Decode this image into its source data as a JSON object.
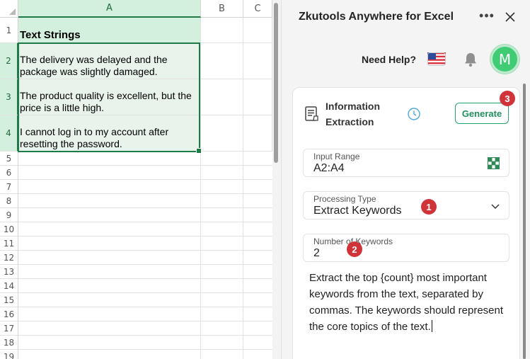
{
  "sheet": {
    "columns": [
      "A",
      "B",
      "C"
    ],
    "rows": [
      "1",
      "2",
      "3",
      "4",
      "5",
      "6",
      "7",
      "8",
      "9",
      "10",
      "11",
      "12",
      "13",
      "14",
      "15",
      "16",
      "17",
      "18",
      "19"
    ],
    "cells": {
      "a1": "Text Strings",
      "a2": "The delivery was delayed and the package was slightly damaged.",
      "a3": "The product quality is excellent, but the price is a little high.",
      "a4": "I cannot log in to my account after resetting the password."
    }
  },
  "panel": {
    "title": "Zkutools Anywhere for Excel",
    "help": "Need Help?",
    "avatar_letter": "M",
    "card": {
      "title": "Information Extraction",
      "generate_label": "Generate",
      "input_range_label": "Input Range",
      "input_range_value": "A2:A4",
      "processing_type_label": "Processing Type",
      "processing_type_value": "Extract Keywords",
      "keywords_label": "Number of Keywords",
      "keywords_value": "2",
      "prompt": "Extract the top {count} most important keywords from the text, separated by commas. The keywords should represent the core topics of the text."
    },
    "badges": [
      "1",
      "2",
      "3"
    ]
  },
  "colors": {
    "accent": "#1e7b45",
    "badge": "#d13438",
    "button": "#28a06a",
    "avatar": "#3fcc74"
  },
  "icons": [
    "more-icon",
    "close-icon",
    "us-flag-icon",
    "bell-icon",
    "document-icon",
    "clock-icon",
    "grid-select-icon",
    "chevron-down-icon"
  ]
}
